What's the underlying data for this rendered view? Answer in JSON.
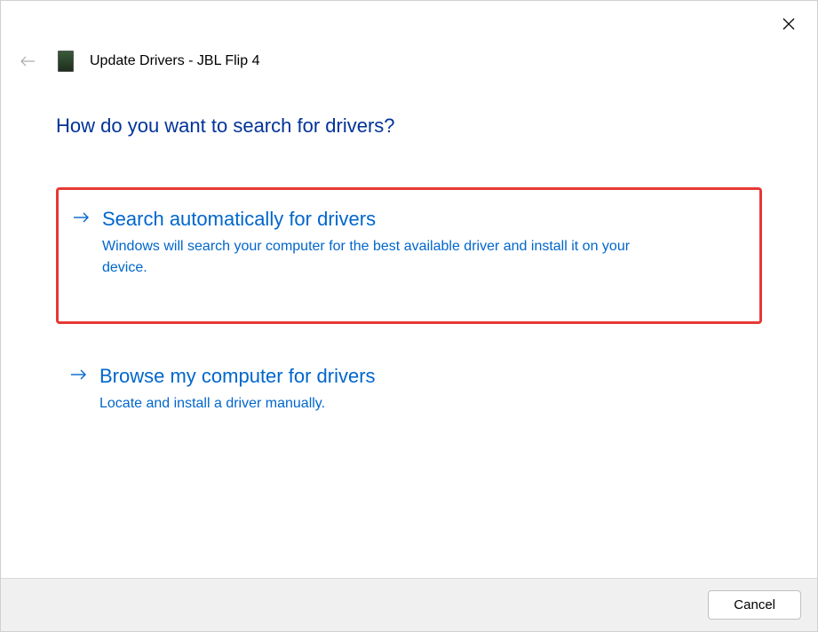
{
  "header": {
    "title": "Update Drivers - JBL Flip 4"
  },
  "main": {
    "heading": "How do you want to search for drivers?",
    "options": [
      {
        "title": "Search automatically for drivers",
        "description": "Windows will search your computer for the best available driver and install it on your device."
      },
      {
        "title": "Browse my computer for drivers",
        "description": "Locate and install a driver manually."
      }
    ]
  },
  "footer": {
    "cancel_label": "Cancel"
  }
}
